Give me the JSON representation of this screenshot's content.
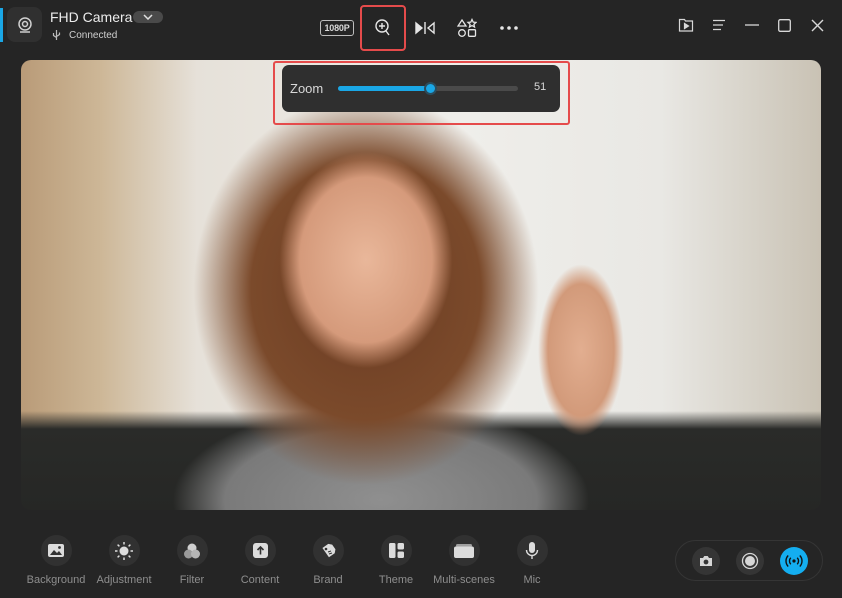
{
  "device": {
    "name": "FHD Camera",
    "status": "Connected"
  },
  "toolbar": {
    "resolution_label": "1080P",
    "icons": [
      "resolution-badge",
      "zoom-in-icon",
      "mirror-flip-icon",
      "shapes-icon",
      "more-icon"
    ],
    "active_tool": "zoom"
  },
  "window_controls": {
    "icons": [
      "recordings-folder-icon",
      "menu-icon",
      "minimize-icon",
      "maximize-icon",
      "close-icon"
    ]
  },
  "zoom_panel": {
    "label": "Zoom",
    "value": "51",
    "percent": 51,
    "accent": "#1aa7e6"
  },
  "bottom_bar": {
    "items": [
      {
        "label": "Background",
        "icon": "image-icon"
      },
      {
        "label": "Adjustment",
        "icon": "sun-icon"
      },
      {
        "label": "Filter",
        "icon": "filter-circles-icon"
      },
      {
        "label": "Content",
        "icon": "upload-icon"
      },
      {
        "label": "Brand",
        "icon": "tag-icon"
      },
      {
        "label": "Theme",
        "icon": "layout-icon"
      },
      {
        "label": "Multi-scenes",
        "icon": "scenes-icon"
      },
      {
        "label": "Mic",
        "icon": "mic-icon"
      }
    ]
  },
  "capture": {
    "buttons": [
      "snapshot",
      "record",
      "live"
    ],
    "live_color": "#14aef0"
  },
  "colors": {
    "highlight": "#e54b4b",
    "background": "#252525"
  }
}
